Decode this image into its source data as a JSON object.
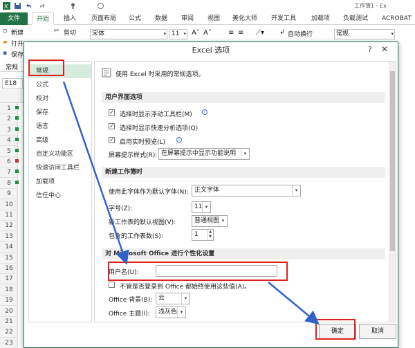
{
  "quick_access": [
    "save-icon",
    "undo-icon",
    "redo-icon",
    "touch-icon",
    "customize-icon"
  ],
  "window_title": "工作簿1 - Ex",
  "ribbon_tabs": [
    "文件",
    "开始",
    "插入",
    "页面布局",
    "公式",
    "数据",
    "审阅",
    "视图",
    "美化大师",
    "开发工具",
    "加载项",
    "负载测试",
    "ACROBAT"
  ],
  "ribbon": {
    "new": "新建",
    "cut": "剪切",
    "open": "打开",
    "save": "保存",
    "font_name": "宋体",
    "font_size": "11",
    "wrap_text": "自动换行",
    "number_format": "常规",
    "group_common": "常规",
    "hint_right": "在线",
    "fill_label": "宿"
  },
  "name_box": "E18",
  "row_numbers": [
    "1",
    "2",
    "3",
    "4",
    "5",
    "6",
    "7",
    "8",
    "9",
    "10",
    "11",
    "12",
    "13",
    "14",
    "15",
    "16",
    "17",
    "18",
    "19",
    "20",
    "21",
    "22",
    "23"
  ],
  "dialog": {
    "title": "Excel 选项",
    "help": "?",
    "close": "✕",
    "nav": [
      "常规",
      "公式",
      "校对",
      "保存",
      "语言",
      "高级",
      "自定义功能区",
      "快速访问工具栏",
      "加载项",
      "信任中心"
    ],
    "intro": "使用 Excel 时采用的常规选项。",
    "sections": {
      "ui": "用户界面选项",
      "new_workbook": "新建工作簿时",
      "personalize": "对 Microsoft Office 进行个性化设置"
    },
    "options": {
      "mini_toolbar": "选择时显示浮动工具栏(M)",
      "quick_analysis": "选择时显示快速分析选项(Q)",
      "live_preview": "启用实时预览(L)",
      "screentip_label": "屏幕提示样式(R):",
      "screentip_value": "在屏幕提示中显示功能说明",
      "default_font_label": "使用此字体作为默认字体(N):",
      "default_font_value": "正文字体",
      "font_size_label": "字号(Z):",
      "font_size_value": "11",
      "default_view_label": "新工作表的默认视图(V):",
      "default_view_value": "普通视图",
      "sheet_count_label": "包含的工作表数(S):",
      "sheet_count_value": "1",
      "username_label": "用户名(U):",
      "username_value": "",
      "always_use": "不管是否登录到 Office 都始终使用这些值(A)。",
      "background_label": "Office 背景(B):",
      "background_value": "云",
      "theme_label": "Office 主题(I):",
      "theme_value": "浅灰色"
    },
    "ok": "确定",
    "cancel": "取消"
  },
  "colors": {
    "excel_green": "#217346",
    "highlight_red": "#e02020",
    "arrow_blue": "#2f63c9"
  }
}
